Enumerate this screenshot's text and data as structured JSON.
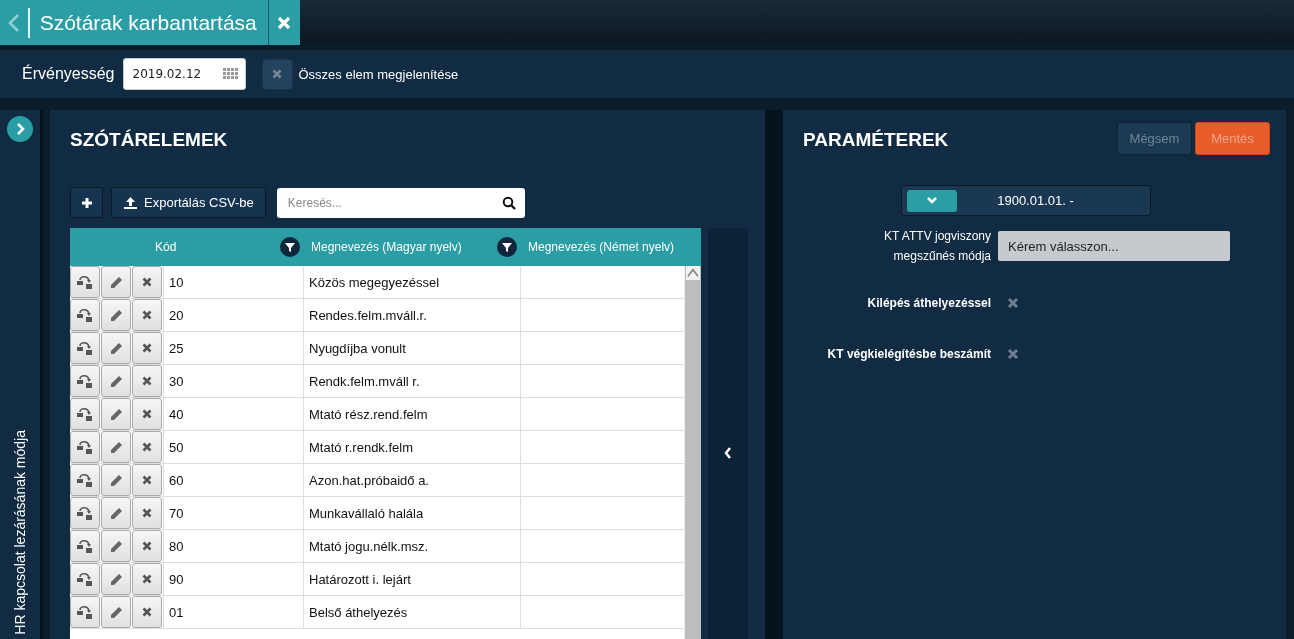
{
  "header_tab": {
    "title": "Szótárak karbantartása"
  },
  "toolbar": {
    "validity_label": "Érvényesség",
    "date": "2019.02.12",
    "show_all": {
      "label": "Összes elem megjelenítése",
      "checked": false
    }
  },
  "side_strip": {
    "label": "HR kapcsolat lezárásának módja"
  },
  "list_panel": {
    "title": "SZÓTÁRELEMEK",
    "export_button": "Exportálás CSV-be",
    "search": {
      "placeholder": "Keresés..."
    },
    "columns": [
      "Kód",
      "Megnevezés (Magyar nyelv)",
      "Megnevezés (Német nyelv)"
    ],
    "rows": [
      {
        "code": "10",
        "name_hu": "Közös megegyezéssel",
        "name_de": ""
      },
      {
        "code": "20",
        "name_hu": "Rendes.felm.mváll.r.",
        "name_de": ""
      },
      {
        "code": "25",
        "name_hu": "Nyugdíjba vonult",
        "name_de": ""
      },
      {
        "code": "30",
        "name_hu": "Rendk.felm.mváll r.",
        "name_de": ""
      },
      {
        "code": "40",
        "name_hu": "Mtató rész.rend.felm",
        "name_de": ""
      },
      {
        "code": "50",
        "name_hu": "Mtató r.rendk.felm",
        "name_de": ""
      },
      {
        "code": "60",
        "name_hu": "Azon.hat.próbaidő a.",
        "name_de": ""
      },
      {
        "code": "70",
        "name_hu": "Munkavállaló halála",
        "name_de": ""
      },
      {
        "code": "80",
        "name_hu": "Mtató jogu.nélk.msz.",
        "name_de": ""
      },
      {
        "code": "90",
        "name_hu": "Határozott i. lejárt",
        "name_de": ""
      },
      {
        "code": "01",
        "name_hu": "Belső áthelyezés",
        "name_de": ""
      }
    ]
  },
  "params_panel": {
    "title": "PARAMÉTEREK",
    "cancel_button": "Mégsem",
    "save_button": "Mentés",
    "period": "1900.01.01. -",
    "fields": [
      {
        "kind": "select",
        "label": "KT ATTV jogviszony megszűnés módja",
        "placeholder": "Kérem válasszon..."
      },
      {
        "kind": "checkbox",
        "label": "Kilépés áthelyezéssel",
        "checked": false
      },
      {
        "kind": "checkbox",
        "label": "KT végkielégítésbe beszámít",
        "checked": false
      }
    ]
  }
}
